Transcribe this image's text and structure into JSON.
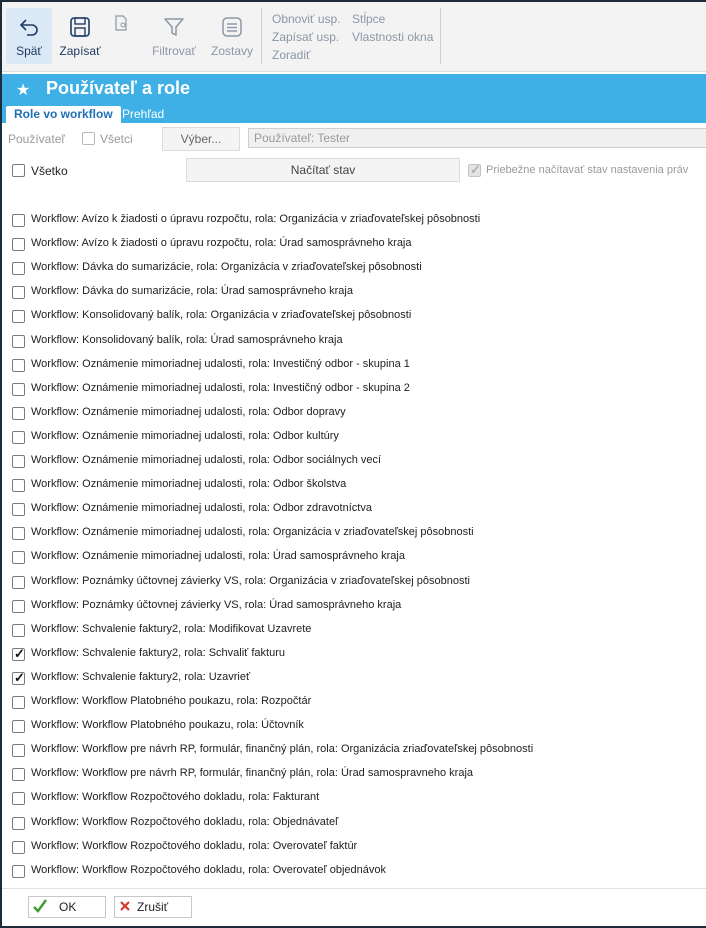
{
  "toolbar": {
    "back_label": "Späť",
    "save_label": "Zapísať",
    "filter_label": "Filtrovať",
    "reports_label": "Zostavy",
    "refresh_label": "Obnoviť usp.",
    "write_label": "Zapísať usp.",
    "sort_label": "Zoradiť",
    "columns_label": "Stĺpce",
    "props_label": "Vlastnosti okna"
  },
  "header": {
    "title": "Používateľ a role"
  },
  "tabs": [
    {
      "label": "Role vo workflow"
    },
    {
      "label": "Prehľad"
    }
  ],
  "filter": {
    "user_label": "Používateľ",
    "all_label": "Všetci",
    "select_button": "Výber...",
    "user_value": "Používateľ: Tester"
  },
  "controls": {
    "everything_label": "Všetko",
    "load_state_button": "Načítať stav",
    "continuous_label": "Priebežne načítavať stav nastavenia práv"
  },
  "roles": [
    {
      "label": "Workflow: Avízo k žiadosti o úpravu rozpočtu, rola: Organizácia v zriaďovateľskej pôsobnosti",
      "checked": false
    },
    {
      "label": "Workflow: Avízo k žiadosti o úpravu rozpočtu, rola: Úrad samosprávneho kraja",
      "checked": false
    },
    {
      "label": "Workflow: Dávka do sumarizácie, rola: Organizácia v zriaďovateľskej pôsobnosti",
      "checked": false
    },
    {
      "label": "Workflow: Dávka do sumarizácie, rola: Úrad samosprávneho kraja",
      "checked": false
    },
    {
      "label": "Workflow: Konsolidovaný balík, rola: Organizácia v zriaďovateľskej pôsobnosti",
      "checked": false
    },
    {
      "label": "Workflow: Konsolidovaný balík, rola: Úrad samosprávneho kraja",
      "checked": false
    },
    {
      "label": "Workflow: Oznámenie mimoriadnej udalosti, rola: Investičný odbor - skupina 1",
      "checked": false
    },
    {
      "label": "Workflow: Oznámenie mimoriadnej udalosti, rola: Investičný odbor - skupina 2",
      "checked": false
    },
    {
      "label": "Workflow: Oznámenie mimoriadnej udalosti, rola: Odbor dopravy",
      "checked": false
    },
    {
      "label": "Workflow: Oznámenie mimoriadnej udalosti, rola: Odbor kultúry",
      "checked": false
    },
    {
      "label": "Workflow: Oznámenie mimoriadnej udalosti, rola: Odbor sociálnych vecí",
      "checked": false
    },
    {
      "label": "Workflow: Oznámenie mimoriadnej udalosti, rola: Odbor školstva",
      "checked": false
    },
    {
      "label": "Workflow: Oznámenie mimoriadnej udalosti, rola: Odbor zdravotníctva",
      "checked": false
    },
    {
      "label": "Workflow: Oznámenie mimoriadnej udalosti, rola: Organizácia v zriaďovateľskej pôsobnosti",
      "checked": false
    },
    {
      "label": "Workflow: Oznámenie mimoriadnej udalosti, rola: Úrad samosprávneho kraja",
      "checked": false
    },
    {
      "label": "Workflow: Poznámky účtovnej závierky VS, rola: Organizácia v zriaďovateľskej pôsobnosti",
      "checked": false
    },
    {
      "label": "Workflow: Poznámky účtovnej závierky VS, rola: Úrad samosprávneho kraja",
      "checked": false
    },
    {
      "label": "Workflow: Schvalenie faktury2, rola: Modifikovat Uzavrete",
      "checked": false
    },
    {
      "label": "Workflow: Schvalenie faktury2, rola: Schvaliť fakturu",
      "checked": true
    },
    {
      "label": "Workflow: Schvalenie faktury2, rola: Uzavrieť",
      "checked": true
    },
    {
      "label": "Workflow: Workflow Platobného poukazu, rola: Rozpočtár",
      "checked": false
    },
    {
      "label": "Workflow: Workflow Platobného poukazu, rola: Účtovník",
      "checked": false
    },
    {
      "label": "Workflow: Workflow pre návrh RP, formulár, finančný plán, rola: Organizácia zriaďovateľskej pôsobnosti",
      "checked": false
    },
    {
      "label": "Workflow: Workflow pre návrh RP, formulár, finančný plán, rola: Úrad samospravneho kraja",
      "checked": false
    },
    {
      "label": "Workflow: Workflow Rozpočtového dokladu, rola: Fakturant",
      "checked": false
    },
    {
      "label": "Workflow: Workflow Rozpočtového dokladu, rola: Objednávateľ",
      "checked": false
    },
    {
      "label": "Workflow: Workflow Rozpočtového dokladu, rola: Overovateľ faktúr",
      "checked": false
    },
    {
      "label": "Workflow: Workflow Rozpočtového dokladu, rola: Overovateľ objednávok",
      "checked": false
    }
  ],
  "footer": {
    "ok_label": "OK",
    "cancel_label": "Zrušiť"
  },
  "colors": {
    "accent": "#3eb0e6",
    "ok_icon": "#3a9a2a",
    "cancel_icon": "#d43a2f"
  }
}
